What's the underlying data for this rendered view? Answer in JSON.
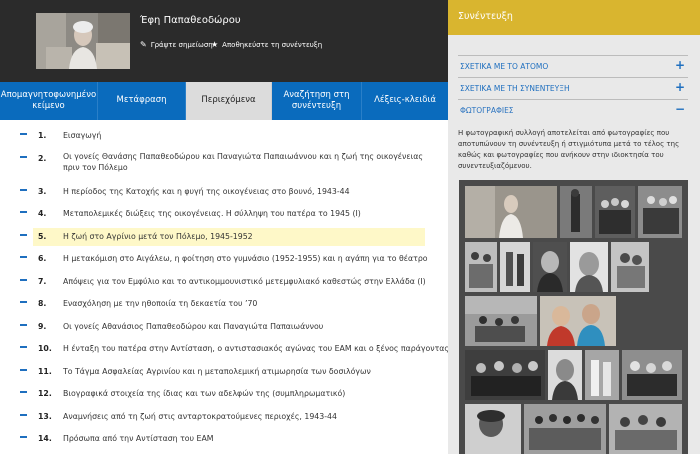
{
  "interviewee": {
    "name": "Έφη Παπαθεοδώρου",
    "actions": [
      {
        "label": "Γράψτε σημείωση",
        "icon": "pencil-icon"
      },
      {
        "label": "Αποθηκεύστε τη συνέντευξη",
        "icon": "star-icon"
      }
    ]
  },
  "tabs": [
    {
      "label": "Απομαγνητοφωνημένο κείμενο",
      "active": false
    },
    {
      "label": "Μετάφραση",
      "active": false
    },
    {
      "label": "Περιεχόμενα",
      "active": true
    },
    {
      "label": "Αναζήτηση στη συνέντευξη",
      "active": false
    },
    {
      "label": "Λέξεις-κλειδιά",
      "active": false
    }
  ],
  "chapters": [
    {
      "num": "1.",
      "text": "Εισαγωγή"
    },
    {
      "num": "2.",
      "text": "Οι γονείς Θανάσης Παπαθεοδώρου και Παναγιώτα Παπαιωάννου και η ζωή της οικογένειας πριν τον Πόλεμο"
    },
    {
      "num": "3.",
      "text": "Η περίοδος της Κατοχής και η φυγή της οικογένειας στο βουνό, 1943-44"
    },
    {
      "num": "4.",
      "text": "Μεταπολεμικές διώξεις της οικογένειας. Η σύλληψη του πατέρα το 1945 (Ι)"
    },
    {
      "num": "5.",
      "text": "Η ζωή στο Αγρίνιο μετά τον Πόλεμο, 1945-1952",
      "selected": true
    },
    {
      "num": "6.",
      "text": "Η μετακόμιση στο Αιγάλεω, η φοίτηση στο γυμνάσιο (1952-1955) και η αγάπη για το θέατρο"
    },
    {
      "num": "7.",
      "text": "Απόψεις για τον Εμφύλιο και το αντικομμουνιστικό μετεμφυλιακό καθεστώς στην Ελλάδα (Ι)"
    },
    {
      "num": "8.",
      "text": "Ενασχόληση με την ηθοποιία τη δεκαετία του ’70"
    },
    {
      "num": "9.",
      "text": "Οι γονείς Αθανάσιος Παπαθεοδώρου και Παναγιώτα Παπαιωάννου"
    },
    {
      "num": "10.",
      "text": "Η ένταξη του πατέρα στην Αντίσταση, ο αντιστασιακός αγώνας του ΕΑΜ και ο ξένος παράγοντας"
    },
    {
      "num": "11.",
      "text": "Το Τάγμα Ασφαλείας Αγρινίου και η μεταπολεμική ατιμωρησία των δοσιλόγων"
    },
    {
      "num": "12.",
      "text": "Βιογραφικά στοιχεία της ίδιας και των αδελφών της (συμπληρωματικό)"
    },
    {
      "num": "13.",
      "text": "Αναμνήσεις από τη ζωή στις ανταρτοκρατούμενες περιοχές, 1943-44"
    },
    {
      "num": "14.",
      "text": "Πρόσωπα από την Αντίσταση του ΕΑΜ"
    }
  ],
  "sidebar": {
    "title": "Συνέντευξη",
    "accordions": [
      {
        "label": "ΣΧΕΤΙΚΑ ΜΕ ΤΟ ΑΤΟΜΟ",
        "sign": "+"
      },
      {
        "label": "ΣΧΕΤΙΚΑ ΜΕ ΤΗ ΣΥΝΕΝΤΕΥΞΗ",
        "sign": "+"
      },
      {
        "label": "ΦΩΤΟΓΡΑΦΙΕΣ",
        "sign": "−"
      }
    ],
    "photos_description": "Η φωτογραφική συλλογή αποτελείται από φωτογραφίες που αποτυπώνουν τη συνέντευξη ή στιγμιότυπα μετά το τέλος της καθώς και φωτογραφίες που ανήκουν στην ιδιοκτησία του συνεντευξιαζόμενου."
  },
  "colors": {
    "accent_blue": "#0a6bbd",
    "header_yellow": "#d9b52f",
    "highlight": "#fef8c8"
  }
}
